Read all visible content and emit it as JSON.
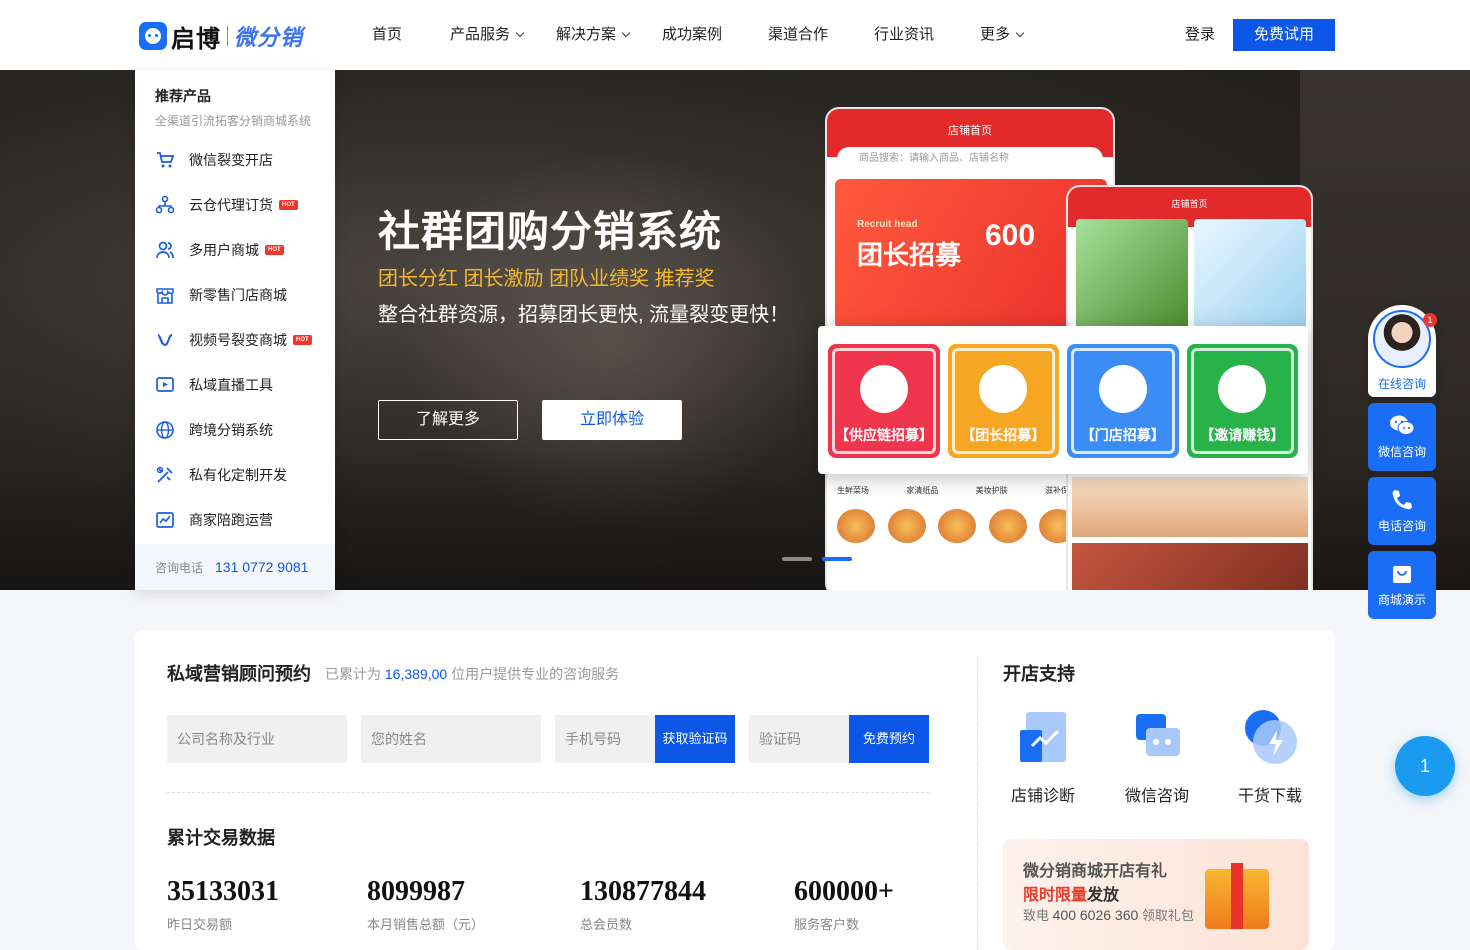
{
  "header": {
    "logo_cn": "启博",
    "logo_sub": "微分销",
    "nav": [
      {
        "label": "首页",
        "dropdown": false
      },
      {
        "label": "产品服务",
        "dropdown": true
      },
      {
        "label": "解决方案",
        "dropdown": true
      },
      {
        "label": "成功案例",
        "dropdown": false
      },
      {
        "label": "渠道合作",
        "dropdown": false
      },
      {
        "label": "行业资讯",
        "dropdown": false
      },
      {
        "label": "更多",
        "dropdown": true
      }
    ],
    "login": "登录",
    "trial": "免费试用"
  },
  "menu": {
    "title": "推荐产品",
    "subtitle": "全渠道引流拓客分销商城系统",
    "items": [
      {
        "label": "微信裂变开店",
        "icon": "cart-icon",
        "hot": ""
      },
      {
        "label": "云仓代理订货",
        "icon": "network-icon",
        "hot": "HOT"
      },
      {
        "label": "多用户商城",
        "icon": "users-icon",
        "hot": "HOT"
      },
      {
        "label": "新零售门店商城",
        "icon": "store-icon",
        "hot": ""
      },
      {
        "label": "视频号裂变商城",
        "icon": "infinity-icon",
        "hot": "HOT"
      },
      {
        "label": "私域直播工具",
        "icon": "live-icon",
        "hot": ""
      },
      {
        "label": "跨境分销系统",
        "icon": "globe-icon",
        "hot": ""
      },
      {
        "label": "私有化定制开发",
        "icon": "tools-icon",
        "hot": ""
      },
      {
        "label": "商家陪跑运营",
        "icon": "chart-icon",
        "hot": ""
      }
    ],
    "phone_label": "咨询电话",
    "phone": "131 0772 9081"
  },
  "banner": {
    "title": "社群团购分销系统",
    "subtitle": "团长分红 团长激励 团队业绩奖 推荐奖",
    "desc": "整合社群资源，招募团长更快, 流量裂变更快！",
    "btn_more": "了解更多",
    "btn_try": "立即体验",
    "slide_active": 2,
    "slide_count": 2,
    "mock": {
      "shop_home": "店铺首页",
      "search": "商品搜索：请输入商品、店铺名称",
      "recruit_en": "Recruit head",
      "recruit": "团长招募",
      "amount": "600",
      "promos": [
        {
          "label": "【供应链招募】",
          "color": "#f0354e"
        },
        {
          "label": "【团长招募】",
          "color": "#f6a623"
        },
        {
          "label": "【门店招募】",
          "color": "#3c8cf6"
        },
        {
          "label": "【邀请赚钱】",
          "color": "#27b24a"
        }
      ],
      "cats": [
        "生鲜菜场",
        "家清纸品",
        "美妆护肤",
        "滋补保健"
      ]
    }
  },
  "float": {
    "online": "在线咨询",
    "badge": "1",
    "wechat": "微信咨询",
    "phone": "电话咨询",
    "demo": "商城演示",
    "circle": "1"
  },
  "consult": {
    "title": "私域营销顾问预约",
    "count_prefix": "已累计为",
    "count": "16,389,00",
    "count_suffix": "位用户提供专业的咨询服务",
    "company_ph": "公司名称及行业",
    "name_ph": "您的姓名",
    "phone_ph": "手机号码",
    "get_code": "获取验证码",
    "code_ph": "验证码",
    "book": "免费预约",
    "stats_title": "累计交易数据",
    "stats": [
      {
        "value": "35133031",
        "label": "昨日交易额"
      },
      {
        "value": "8099987",
        "label": "本月销售总额（元）"
      },
      {
        "value": "130877844",
        "label": "总会员数"
      },
      {
        "value": "600000+",
        "label": "服务客户数"
      }
    ]
  },
  "support": {
    "title": "开店支持",
    "items": [
      {
        "label": "店铺诊断",
        "icon": "diagnose-icon"
      },
      {
        "label": "微信咨询",
        "icon": "chat-icon"
      },
      {
        "label": "干货下载",
        "icon": "download-icon"
      }
    ],
    "gift_title": "微分销商城开店有礼",
    "gift_hl": "限时限量",
    "gift_rest": "发放",
    "gift_pre": "致电",
    "gift_phone": "400 6026 360",
    "gift_post": "领取礼包"
  }
}
